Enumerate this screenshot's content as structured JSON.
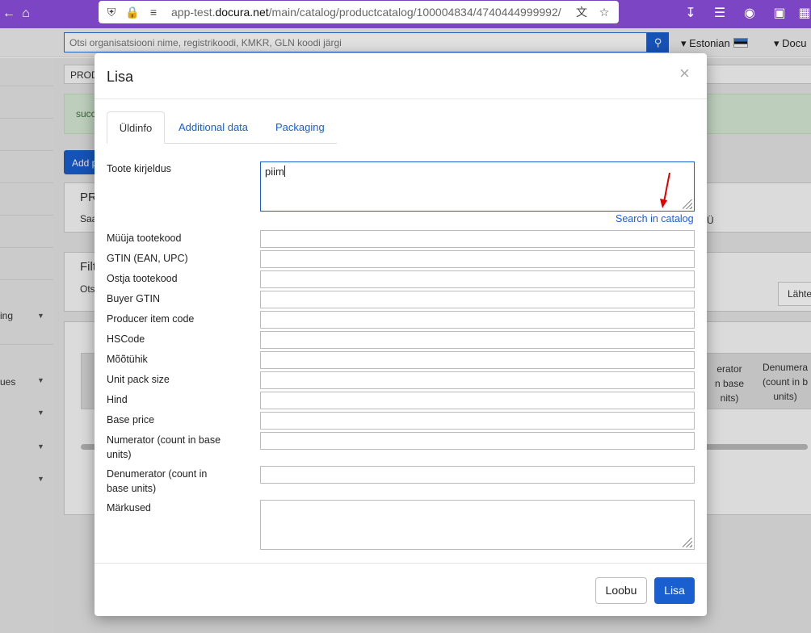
{
  "browser": {
    "url_prefix": "app-test.",
    "url_domain": "docura.net",
    "url_path": "/main/catalog/productcatalog/100004834/4740444999992/",
    "accent": "#7b45c4"
  },
  "header": {
    "search_placeholder": "Otsi organisatsiooni nime, registrikoodi, KMKR, GLN koodi järgi",
    "language": "Estonian",
    "user_menu": "Docu"
  },
  "background": {
    "breadcrumb": "PROD",
    "alert": "succ",
    "add_button": "Add p",
    "section1_title": "PR",
    "section1_text": "Saa",
    "section1_right": "Ü",
    "filter_title": "Filt",
    "filter_text": "Ots",
    "reset_button": "Lähte",
    "table_header_numerator": "erator\nn base\nnits)",
    "table_header_denumerator": "Denumera\n(count in b\nunits)",
    "sidebar_items": [
      "ing",
      "ues"
    ]
  },
  "modal": {
    "title": "Lisa",
    "tabs": [
      {
        "label": "Üldinfo",
        "active": true
      },
      {
        "label": "Additional data",
        "active": false
      },
      {
        "label": "Packaging",
        "active": false
      }
    ],
    "product_description_label": "Toote kirjeldus",
    "product_description_value": "piim",
    "search_in_catalog": "Search in catalog",
    "fields": [
      {
        "label": "Müüja tootekood",
        "value": ""
      },
      {
        "label": "GTIN (EAN, UPC)",
        "value": ""
      },
      {
        "label": "Ostja tootekood",
        "value": ""
      },
      {
        "label": "Buyer GTIN",
        "value": ""
      },
      {
        "label": "Producer item code",
        "value": ""
      },
      {
        "label": "HSCode",
        "value": ""
      },
      {
        "label": "Mõõtühik",
        "value": ""
      },
      {
        "label": "Unit pack size",
        "value": ""
      },
      {
        "label": "Hind",
        "value": ""
      },
      {
        "label": "Base price",
        "value": ""
      },
      {
        "label": "Numerator (count in base units)",
        "value": ""
      },
      {
        "label": "Denumerator (count in base units)",
        "value": ""
      }
    ],
    "notes_label": "Märkused",
    "notes_value": "",
    "cancel_button": "Loobu",
    "submit_button": "Lisa",
    "primary_color": "#1a5fd0",
    "annotation_color": "#e00000"
  }
}
